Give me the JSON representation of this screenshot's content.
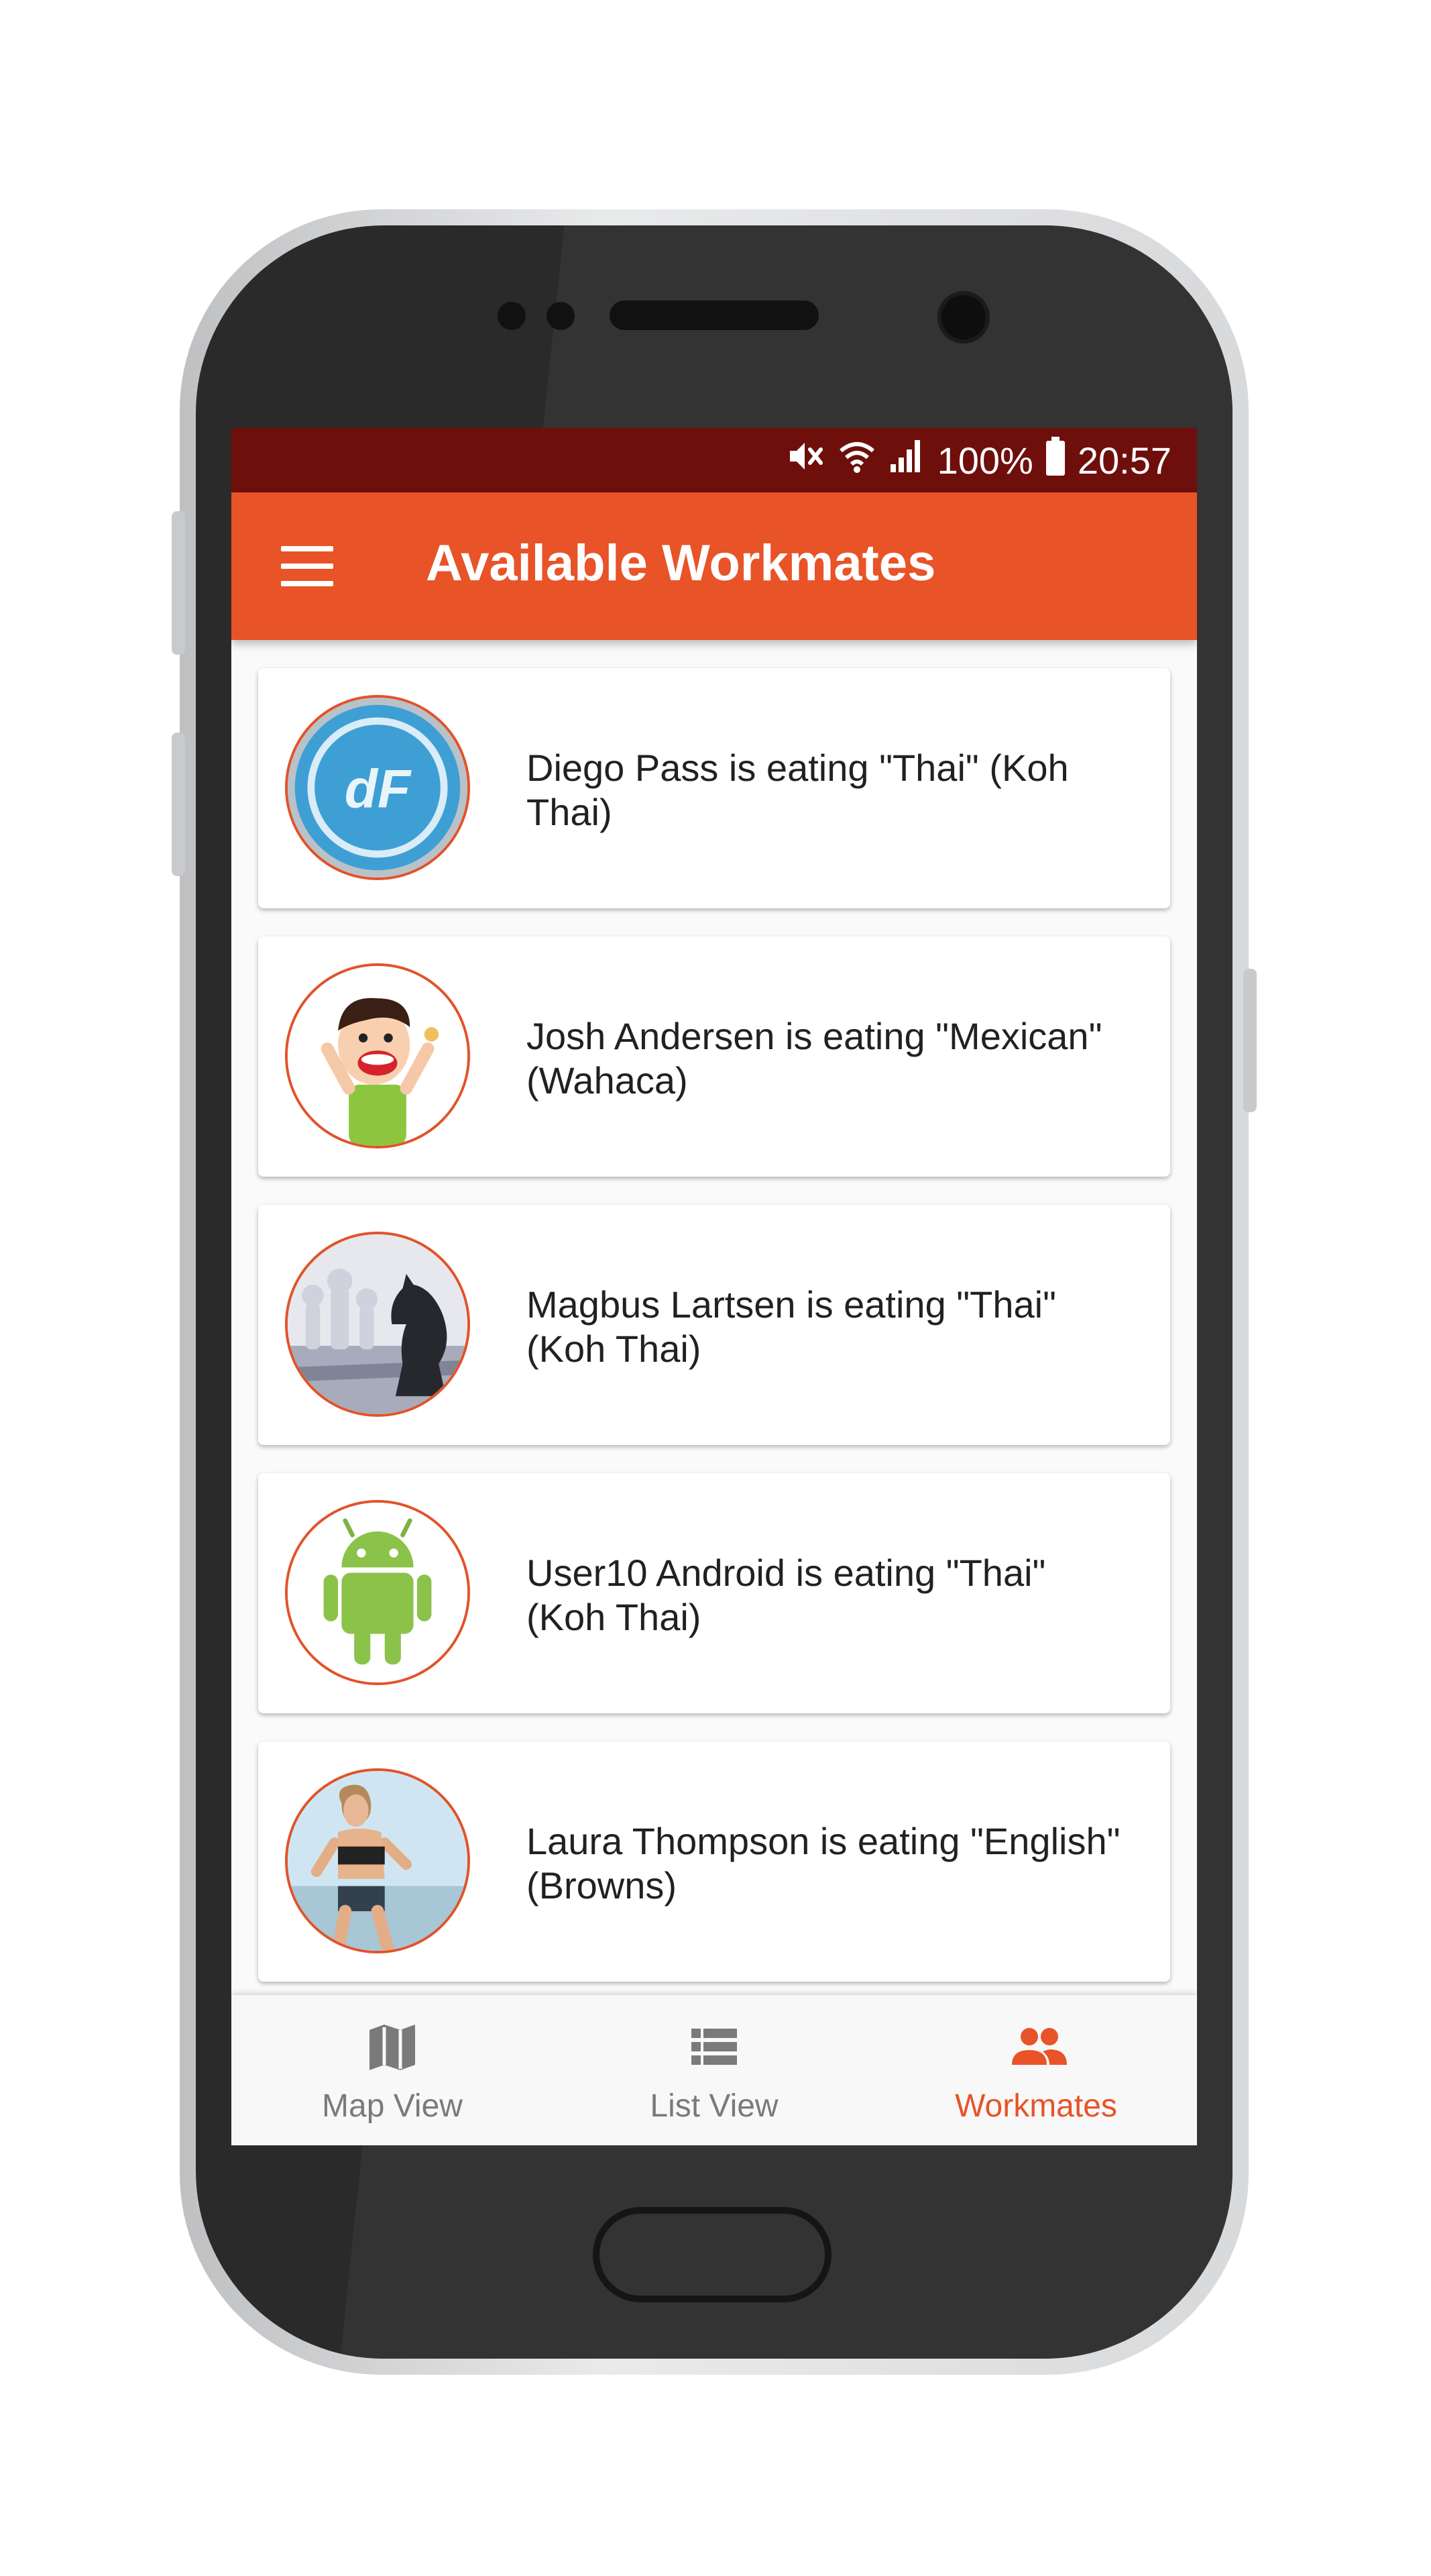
{
  "status_bar": {
    "battery": "100%",
    "time": "20:57",
    "icons": [
      "mute-icon",
      "wifi-icon",
      "signal-icon",
      "battery-icon"
    ]
  },
  "app_bar": {
    "title": "Available Workmates",
    "menu_icon": "menu-icon"
  },
  "workmates": [
    {
      "text": "Diego Pass is eating \"Thai\" (Koh Thai)",
      "avatar": "df-logo"
    },
    {
      "text": "Josh Andersen is eating \"Mexican\" (Wahaca)",
      "avatar": "cartoon-boy"
    },
    {
      "text": "Magbus Lartsen is eating \"Thai\" (Koh Thai)",
      "avatar": "chess-pieces"
    },
    {
      "text": "User10 Android is eating \"Thai\" (Koh Thai)",
      "avatar": "android-robot"
    },
    {
      "text": "Laura Thompson is eating \"English\" (Browns)",
      "avatar": "runner-woman"
    }
  ],
  "bottom_nav": {
    "items": [
      {
        "label": "Map View",
        "icon": "map-icon",
        "active": false
      },
      {
        "label": "List View",
        "icon": "list-icon",
        "active": false
      },
      {
        "label": "Workmates",
        "icon": "people-icon",
        "active": true
      }
    ]
  },
  "colors": {
    "accent": "#e85327",
    "status_bar": "#6e0f0c",
    "inactive": "#7a7a7a"
  }
}
